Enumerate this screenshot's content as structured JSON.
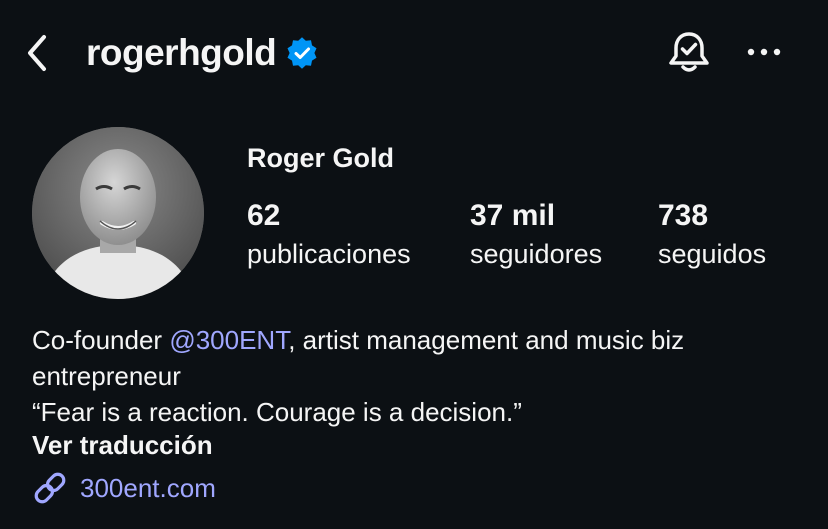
{
  "header": {
    "username": "rogerhgold",
    "icons": [
      "back-icon",
      "verified-badge-icon",
      "notification-bell-icon",
      "more-options-icon"
    ]
  },
  "profile": {
    "display_name": "Roger Gold",
    "stats": [
      {
        "value": "62",
        "label": "publicaciones"
      },
      {
        "value": "37 mil",
        "label": "seguidores"
      },
      {
        "value": "738",
        "label": "seguidos"
      }
    ]
  },
  "bio": {
    "prefix": "Co-founder ",
    "mention": "@300ENT",
    "suffix": ", artist management and music biz entrepreneur",
    "quote": "“Fear is a reaction. Courage is a decision.”",
    "translate_label": "Ver traducción",
    "link_text": "300ent.com"
  },
  "colors": {
    "background": "#0c1014",
    "text": "#f5f5f5",
    "link": "#a0a7ff",
    "verified": "#0095f6"
  }
}
